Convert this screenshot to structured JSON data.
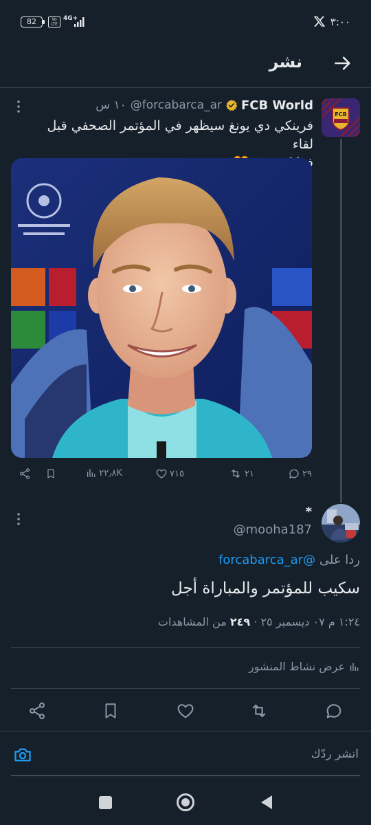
{
  "status_bar": {
    "battery": "82",
    "volte": "Vo LTE",
    "network": "4G+",
    "clock": "٣:٠٠",
    "app_icon": "x-logo-icon"
  },
  "header": {
    "title": "نشر",
    "back_icon": "arrow-right-icon"
  },
  "tweet": {
    "author_name": "FCB World",
    "author_handle": "@forcabarca_ar",
    "time": "١٠ س",
    "avatar_text": "FCB",
    "text_line1": "فرينكي دي يونغ سيظهر في المؤتمر الصحفي قبل لقاء",
    "text_line2": "فرانكفورت 🧡",
    "stats": {
      "replies": "٢٩",
      "retweets": "٢١",
      "likes": "٧١٥",
      "views": "٢٢٫٨K"
    }
  },
  "reply": {
    "display_name": "*",
    "handle": "@mooha187",
    "replying_to_label": "ردا على",
    "replying_to_handle": "@forcabarca_ar",
    "text": "سكيب للمؤتمر والمباراة أجل",
    "timestamp": "١:٢٤ م ٠٧ ديسمبر ٢٥ ·",
    "views_count": "٢٤٩",
    "views_label": "من المشاهدات",
    "activity_label": "عرض نشاط المنشور"
  },
  "compose": {
    "placeholder": "انشر ردّك"
  },
  "colors": {
    "background": "#15202b",
    "accent": "#1d9bf0",
    "verified": "#e8b62c",
    "muted": "#8b98a5"
  }
}
